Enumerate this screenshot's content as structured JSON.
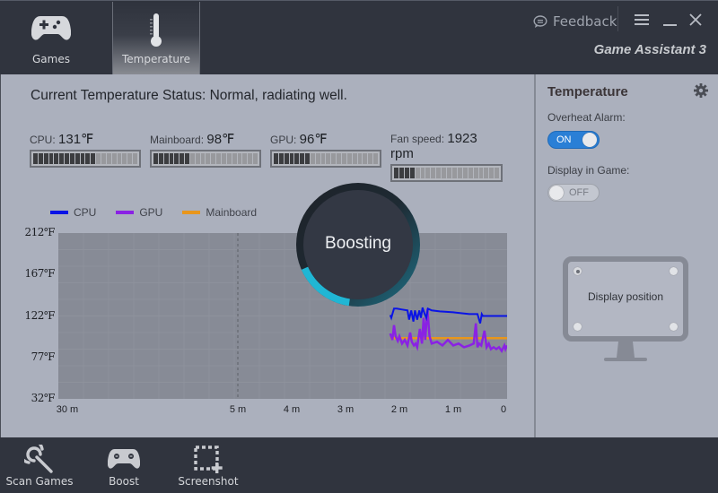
{
  "topbar": {
    "tabs": [
      {
        "label": "Games",
        "icon": "gamepad-icon",
        "active": false
      },
      {
        "label": "Temperature",
        "icon": "thermometer-icon",
        "active": true
      }
    ],
    "feedback_label": "Feedback",
    "brand": "Game Assistant 3"
  },
  "main": {
    "status": "Current Temperature Status: Normal, radiating well.",
    "meters": [
      {
        "label": "CPU: ",
        "value": "131℉",
        "fill_fraction": 0.58
      },
      {
        "label": "Mainboard: ",
        "value": "98℉",
        "fill_fraction": 0.35
      },
      {
        "label": "GPU: ",
        "value": "96℉",
        "fill_fraction": 0.35
      },
      {
        "label": "Fan speed: ",
        "value": "1923 rpm",
        "fill_fraction": 0.18
      }
    ],
    "boost_label": "Boosting",
    "boost_progress": 0.32
  },
  "chart_data": {
    "type": "line",
    "title": "",
    "xlabel": "",
    "ylabel": "",
    "legend": [
      {
        "name": "CPU",
        "color": "#0a14e6"
      },
      {
        "name": "GPU",
        "color": "#8a22e4"
      },
      {
        "name": "Mainboard",
        "color": "#e8961c"
      }
    ],
    "legend_position": "top-left",
    "y_ticks": [
      "212℉",
      "167℉",
      "122℉",
      "77℉",
      "32℉"
    ],
    "y_tick_values": [
      212,
      167,
      122,
      77,
      32
    ],
    "ylim": [
      32,
      212
    ],
    "x_ticks": [
      "30 m",
      "5 m",
      "4 m",
      "3 m",
      "2 m",
      "1 m",
      "0"
    ],
    "x_tick_minutes": [
      30,
      5,
      4,
      3,
      2,
      1,
      0
    ],
    "x_unit": "minutes ago",
    "grid": true,
    "series": [
      {
        "name": "CPU",
        "x_minutes_ago": [
          2.17,
          2.15,
          2.13,
          2.1,
          2.05,
          1.95,
          1.85,
          1.82,
          1.78,
          1.74,
          1.71,
          1.67,
          1.63,
          1.6,
          1.57,
          1.53,
          1.5,
          1.47,
          1.4,
          1.25,
          1.0,
          0.7,
          0.55,
          0.5,
          0.47,
          0.45,
          0.4,
          0.0
        ],
        "values": [
          123,
          120,
          124,
          130,
          130,
          129,
          128,
          118,
          128,
          116,
          128,
          118,
          128,
          120,
          131,
          124,
          120,
          130,
          128,
          127,
          126,
          124,
          124,
          114,
          124,
          122,
          122,
          122
        ]
      },
      {
        "name": "GPU",
        "x_minutes_ago": [
          2.17,
          2.13,
          2.1,
          2.07,
          2.03,
          2.0,
          1.95,
          1.9,
          1.85,
          1.8,
          1.77,
          1.73,
          1.7,
          1.67,
          1.62,
          1.58,
          1.55,
          1.52,
          1.48,
          1.44,
          1.4,
          1.3,
          1.2,
          1.1,
          1.0,
          0.9,
          0.8,
          0.7,
          0.62,
          0.58,
          0.55,
          0.52,
          0.48,
          0.42,
          0.38,
          0.34,
          0.3,
          0.25,
          0.2,
          0.15,
          0.1,
          0.05,
          0.03,
          0.0
        ],
        "values": [
          103,
          96,
          112,
          100,
          95,
          100,
          92,
          96,
          90,
          104,
          94,
          90,
          92,
          88,
          108,
          92,
          120,
          96,
          130,
          100,
          92,
          94,
          90,
          96,
          90,
          92,
          88,
          90,
          92,
          114,
          88,
          92,
          90,
          106,
          88,
          92,
          86,
          88,
          86,
          88,
          84,
          90,
          86,
          90
        ]
      },
      {
        "name": "Mainboard",
        "x_minutes_ago": [
          2.17,
          0.0
        ],
        "values": [
          98,
          98
        ]
      }
    ]
  },
  "side": {
    "title": "Temperature",
    "overheat_label": "Overheat Alarm:",
    "overheat_state": "ON",
    "display_label": "Display in Game:",
    "display_state": "OFF",
    "display_position_label": "Display position",
    "selected_position": "top-left"
  },
  "bottom": {
    "buttons": [
      {
        "label": "Scan Games",
        "icon": "scan-icon"
      },
      {
        "label": "Boost",
        "icon": "gamepad-icon"
      },
      {
        "label": "Screenshot",
        "icon": "screenshot-icon"
      }
    ]
  }
}
